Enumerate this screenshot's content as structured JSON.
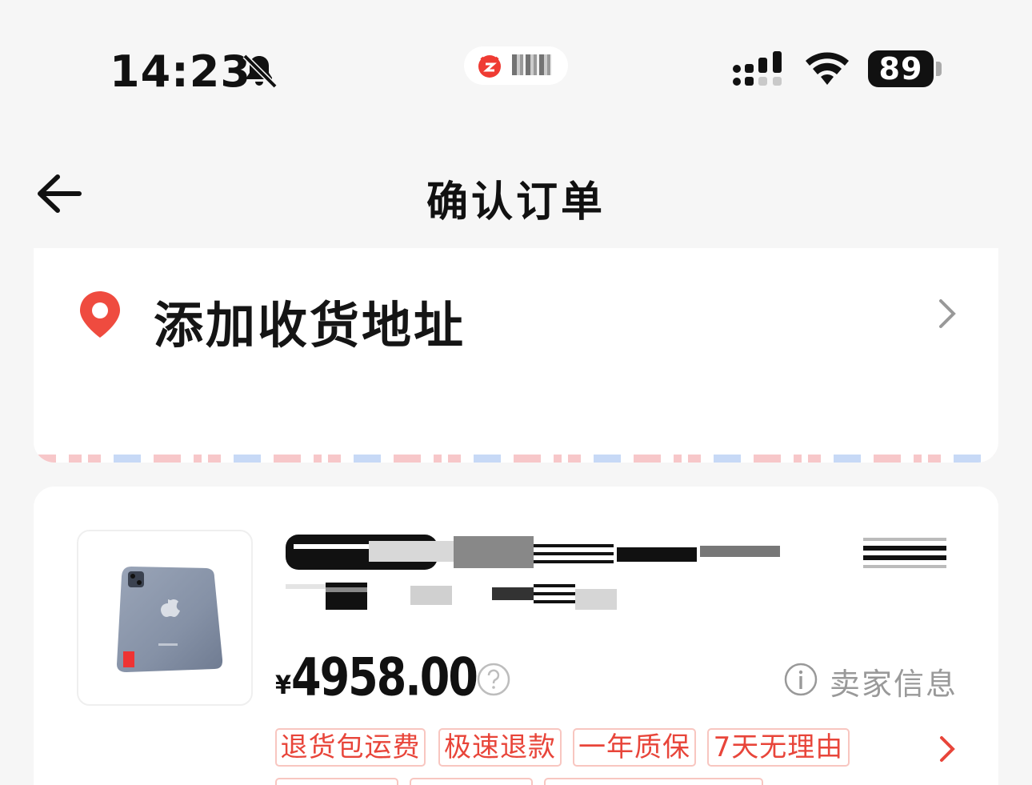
{
  "status_bar": {
    "time": "14:23",
    "battery": "89",
    "icons": [
      "bell-slash-icon",
      "app-icon",
      "signal-icon",
      "wifi-icon",
      "battery-icon"
    ]
  },
  "nav": {
    "title": "确认订单",
    "back_icon": "arrow-left-icon"
  },
  "address": {
    "label": "添加收货地址",
    "icon": "location-pin-icon",
    "accent": "#ef4b3f"
  },
  "product": {
    "currency": "¥",
    "price": "4958.00",
    "seller_info_label": "卖家信息",
    "tags": [
      "退货包运费",
      "极速退款",
      "一年质保",
      "7天无理由"
    ]
  },
  "colors": {
    "accent_red": "#e8453a",
    "background": "#f6f6f6"
  }
}
